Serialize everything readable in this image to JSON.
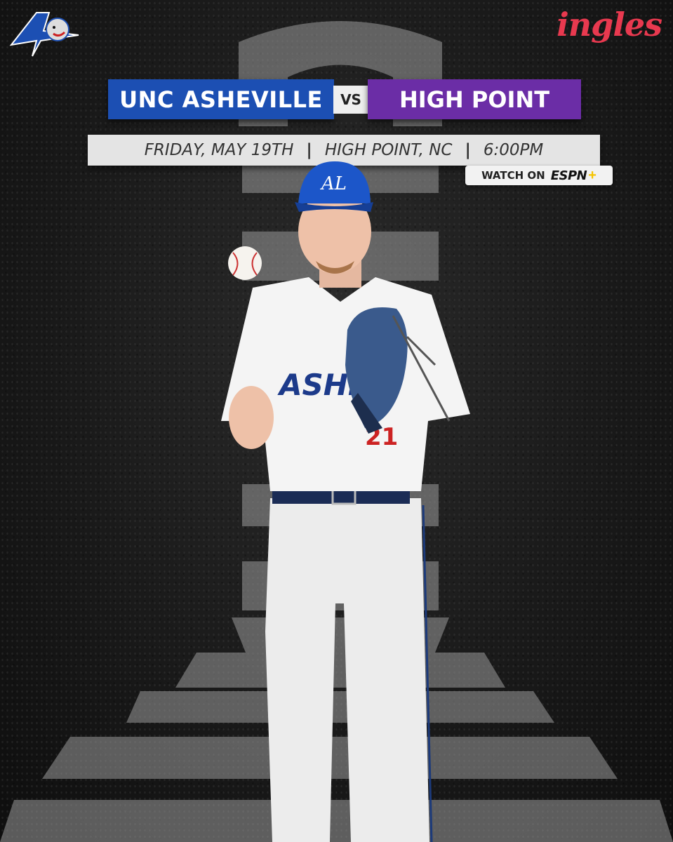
{
  "matchup": {
    "home_team": "UNC ASHEVILLE",
    "vs_label": "VS",
    "away_team": "HIGH POINT"
  },
  "game_info": {
    "date": "FRIDAY, MAY 19TH",
    "location": "HIGH POINT, NC",
    "time": "6:00PM",
    "separator": "|"
  },
  "broadcast": {
    "watch_label": "WATCH ON",
    "network": "ESPN",
    "network_suffix": "+"
  },
  "sponsor": {
    "name": "ingles"
  },
  "jersey": {
    "text": "ASHEVI",
    "number": "21"
  },
  "colors": {
    "home": "#1c4fb3",
    "away": "#6b2da6",
    "sponsor": "#e8394f",
    "espn_plus": "#f5c400"
  },
  "icons": {
    "team_logo": "bulldog-a-logo-icon",
    "baseball": "baseball-icon",
    "glove": "baseball-glove-icon"
  }
}
